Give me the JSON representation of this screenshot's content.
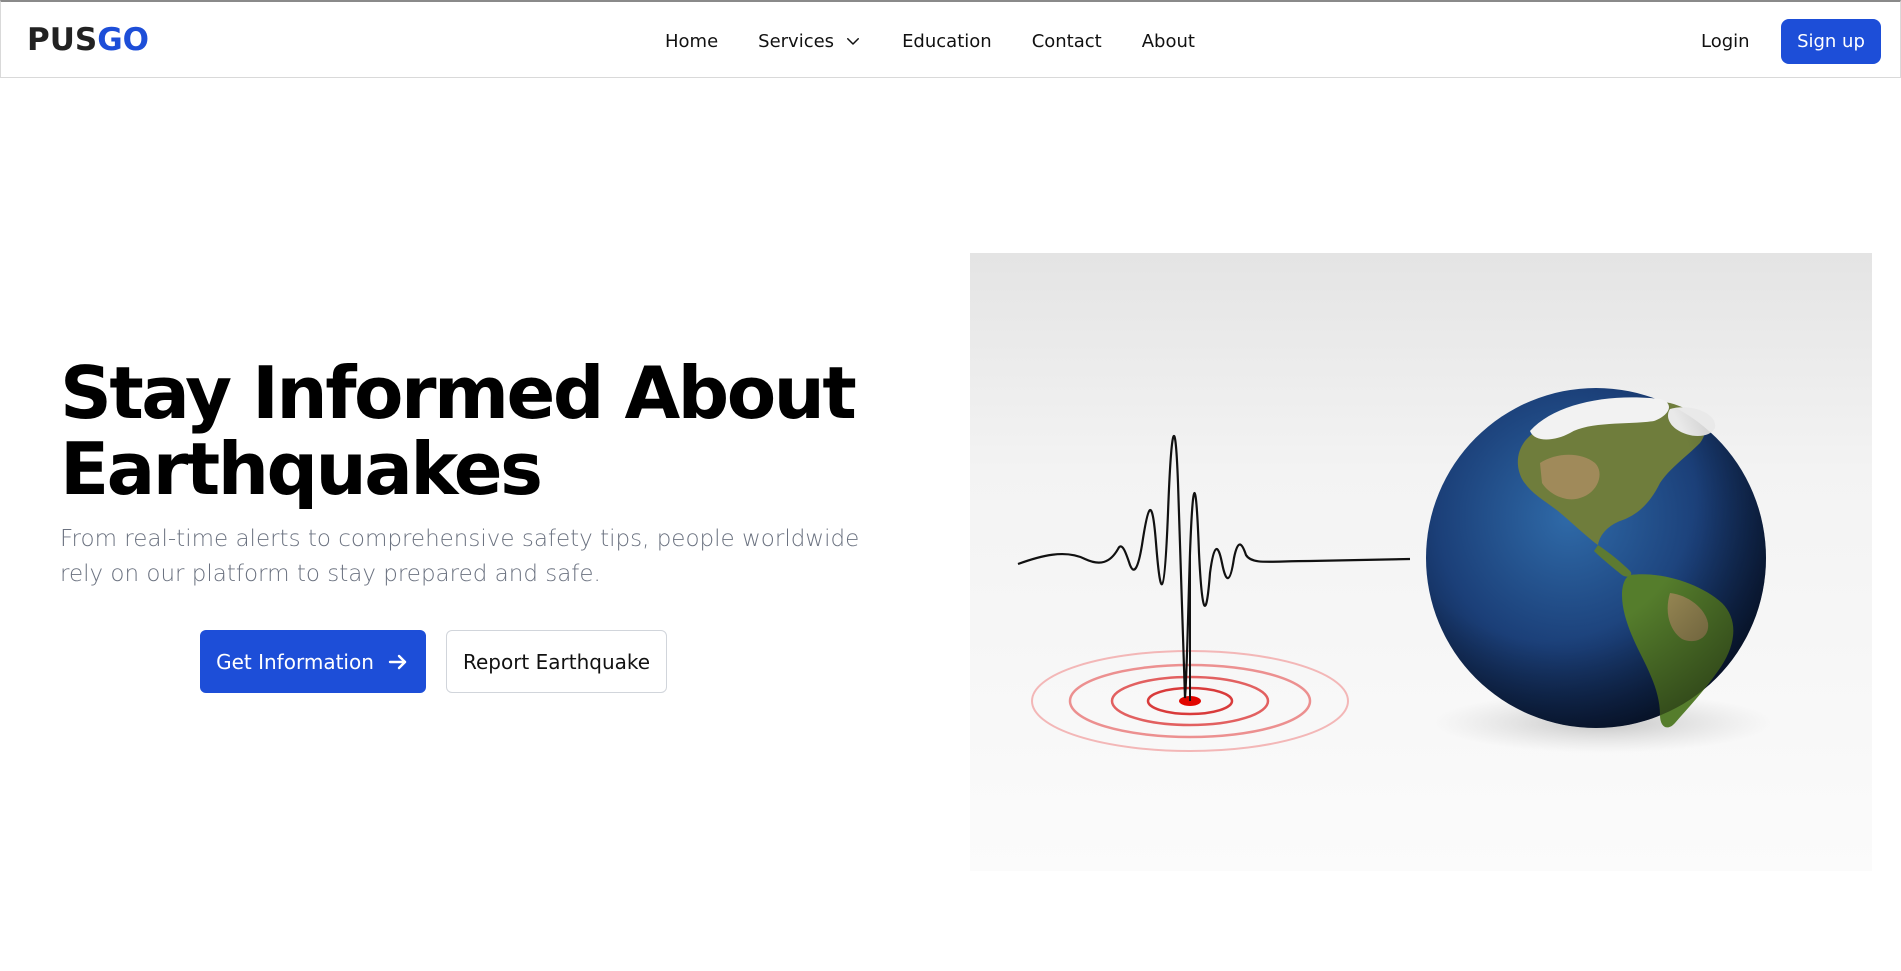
{
  "brand": {
    "part1": "PUS",
    "part2": "GO",
    "color_dark": "#222222",
    "color_accent": "#1d4ed8"
  },
  "nav": {
    "items": [
      {
        "label": "Home"
      },
      {
        "label": "Services",
        "icon": "chevron-down-icon"
      },
      {
        "label": "Education"
      },
      {
        "label": "Contact"
      },
      {
        "label": "About"
      }
    ]
  },
  "auth": {
    "login_label": "Login",
    "signup_label": "Sign up"
  },
  "hero": {
    "title_line1": "Stay Informed About",
    "title_line2": "Earthquakes",
    "subtitle": "From real-time alerts to comprehensive safety tips, people worldwide rely on our platform to stay prepared and safe.",
    "primary_button": "Get Information",
    "primary_button_icon": "arrow-right-icon",
    "secondary_button": "Report Earthquake",
    "image_icon": "seismograph-globe-illustration"
  },
  "colors": {
    "primary": "#1d4ed8",
    "subtitle_text": "#6b7280"
  }
}
